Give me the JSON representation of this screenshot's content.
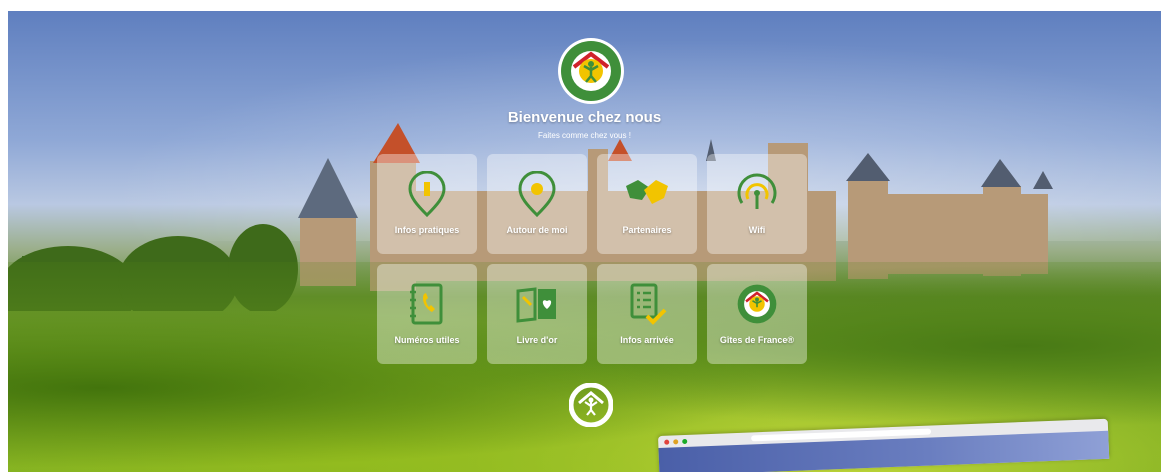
{
  "header": {
    "title": "Bienvenue chez nous",
    "subtitle": "Faites comme chez vous !"
  },
  "logo": {
    "text": "GÎTES DE FRANCE"
  },
  "tiles": [
    {
      "label": "Infos pratiques",
      "icon": "info-pin-icon"
    },
    {
      "label": "Autour de moi",
      "icon": "location-pin-icon"
    },
    {
      "label": "Partenaires",
      "icon": "handshake-icon"
    },
    {
      "label": "Wifi",
      "icon": "wifi-icon"
    },
    {
      "label": "Numéros utiles",
      "icon": "phone-book-icon"
    },
    {
      "label": "Livre d'or",
      "icon": "guestbook-icon"
    },
    {
      "label": "Infos arrivée",
      "icon": "checklist-icon"
    },
    {
      "label": "Gîtes de France®",
      "icon": "gites-logo-icon"
    }
  ],
  "colors": {
    "green": "#3f8f3a",
    "yellow": "#f2c400",
    "red": "#d0222b",
    "tile": "rgba(255,255,255,0.38)"
  }
}
